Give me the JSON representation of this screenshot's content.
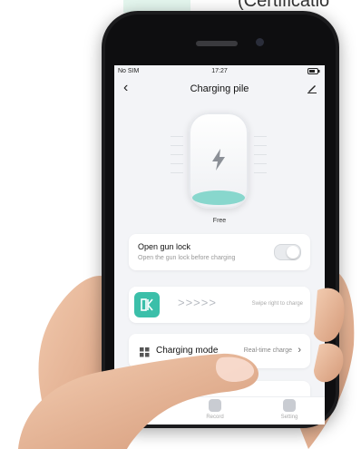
{
  "caption": "(Certificatio",
  "status_bar": {
    "carrier": "No SIM",
    "time": "17:27"
  },
  "nav": {
    "title": "Charging pile"
  },
  "pile": {
    "status": "Free"
  },
  "gun_lock": {
    "title": "Open gun lock",
    "subtitle": "Open the gun lock before charging",
    "enabled": false
  },
  "swipe": {
    "handle_glyph": "N",
    "arrows": ">>>>>",
    "hint": "Swipe right to charge"
  },
  "charging_mode": {
    "label": "Charging mode",
    "value": "Real-time charge"
  },
  "tabs": [
    {
      "label": "Record"
    },
    {
      "label": "Setting"
    }
  ],
  "colors": {
    "accent": "#3bbfa9",
    "water": "#88d7cd",
    "skin": "#e8b99b"
  }
}
